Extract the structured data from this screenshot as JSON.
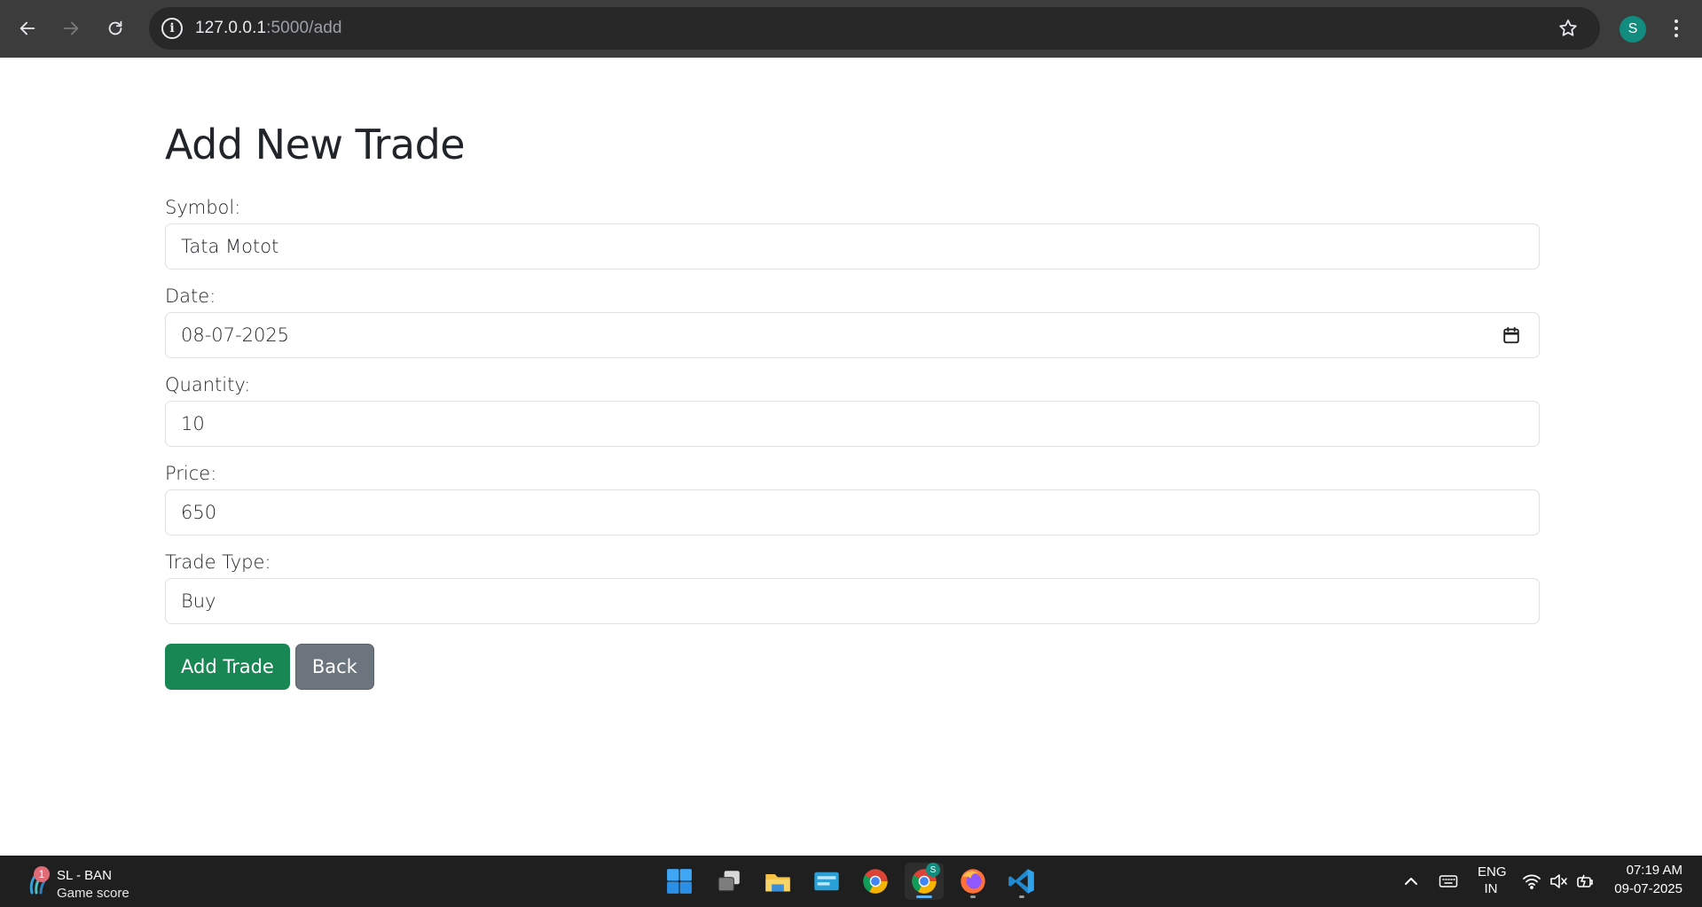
{
  "browser": {
    "url_host": "127.0.0.1",
    "url_rest": ":5000/add",
    "avatar_letter": "S"
  },
  "page": {
    "title": "Add New Trade",
    "fields": {
      "symbol": {
        "label": "Symbol:",
        "value": "Tata Motot"
      },
      "date": {
        "label": "Date:",
        "value": "08-07-2025"
      },
      "quantity": {
        "label": "Quantity:",
        "value": "10"
      },
      "price": {
        "label": "Price:",
        "value": "650"
      },
      "trade_type": {
        "label": "Trade Type:",
        "value": "Buy"
      }
    },
    "buttons": {
      "add": "Add Trade",
      "back": "Back"
    },
    "colors": {
      "success": "#198754",
      "secondary": "#6c757d"
    }
  },
  "taskbar": {
    "widget": {
      "badge": "1",
      "title": "SL - BAN",
      "subtitle": "Game score"
    },
    "chrome_badge": "S",
    "language": {
      "line1": "ENG",
      "line2": "IN"
    },
    "clock": {
      "time": "07:19 AM",
      "date": "09-07-2025"
    }
  }
}
